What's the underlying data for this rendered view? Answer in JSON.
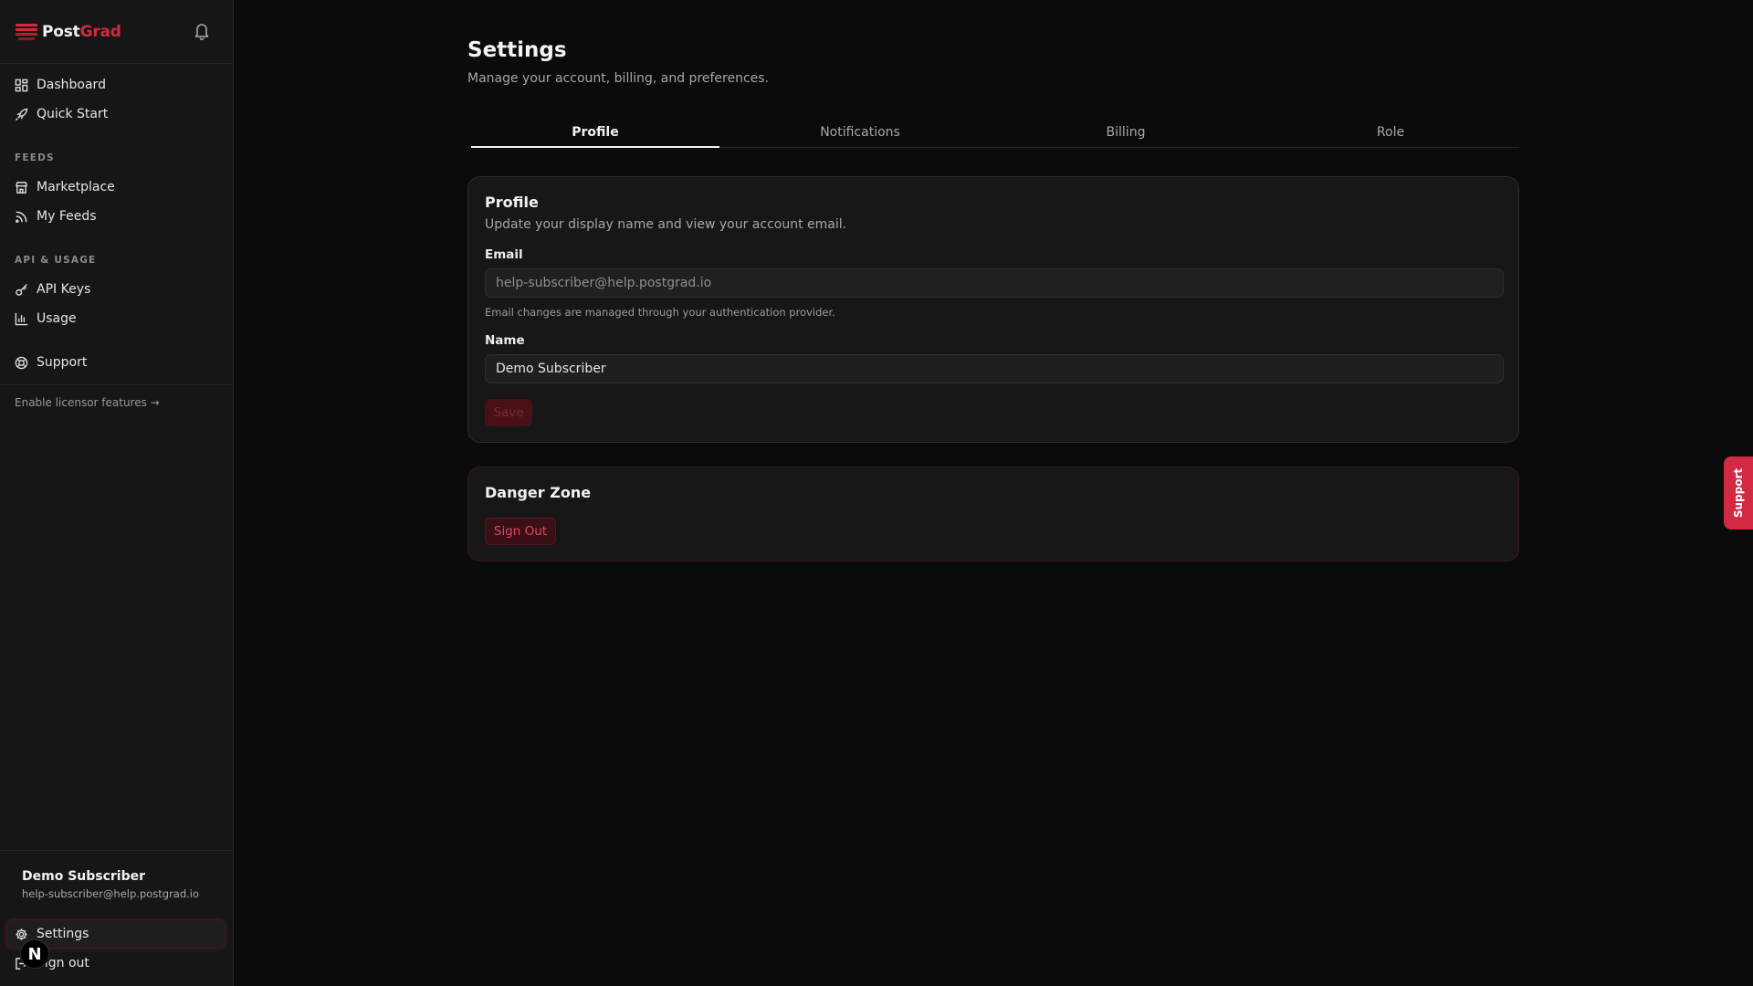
{
  "brand": {
    "post": "Post",
    "grad": "Grad"
  },
  "nav": {
    "dashboard": "Dashboard",
    "quick_start": "Quick Start",
    "feeds_section": "FEEDS",
    "marketplace": "Marketplace",
    "my_feeds": "My Feeds",
    "api_section": "API & USAGE",
    "api_keys": "API Keys",
    "usage": "Usage",
    "support": "Support",
    "licensor": "Enable licensor features →",
    "settings": "Settings",
    "sign_out": "Sign out"
  },
  "user": {
    "name": "Demo Subscriber",
    "email": "help-subscriber@help.postgrad.io",
    "avatar_letter": "N"
  },
  "page": {
    "title": "Settings",
    "subtitle": "Manage your account, billing, and preferences."
  },
  "tabs": [
    "Profile",
    "Notifications",
    "Billing",
    "Role"
  ],
  "active_tab": "Profile",
  "profile": {
    "title": "Profile",
    "description": "Update your display name and view your account email.",
    "email_label": "Email",
    "email_placeholder": "help-subscriber@help.postgrad.io",
    "email_hint": "Email changes are managed through your authentication provider.",
    "name_label": "Name",
    "name_value": "Demo Subscriber",
    "save_label": "Save"
  },
  "danger": {
    "title": "Danger Zone",
    "sign_out_label": "Sign Out"
  },
  "support_tab": "Support",
  "colors": {
    "accent": "#d6293e",
    "background": "#0b0b0b",
    "sidebar": "#161616",
    "card": "#171717"
  },
  "icons": [
    "postgrad-logo-icon",
    "bell-icon",
    "dashboard-icon",
    "rocket-icon",
    "store-icon",
    "rss-icon",
    "key-icon",
    "bar-chart-icon",
    "lifebuoy-icon",
    "gear-icon",
    "log-out-icon"
  ]
}
